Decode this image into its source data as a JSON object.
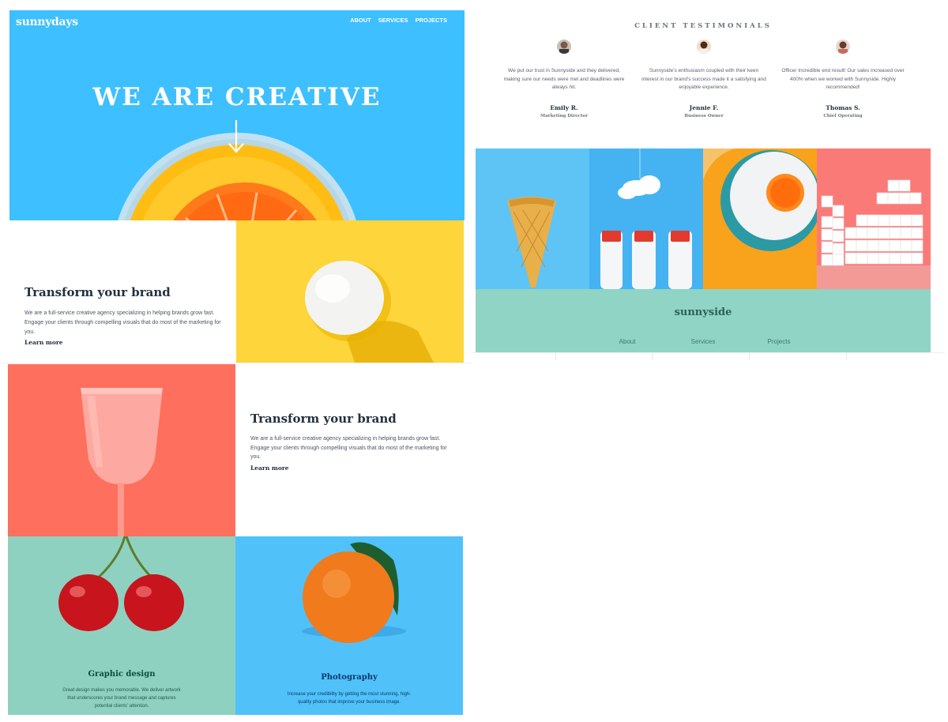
{
  "hero": {
    "logo": "sunnydays",
    "nav": [
      "ABOUT",
      "SERVICES",
      "PROJECTS"
    ],
    "title": "WE ARE CREATIVE"
  },
  "section_one": {
    "title": "Transform your brand",
    "text": "We are a full-service creative agency specializing in helping brands grow fast. Engage your clients through compelling visuals that do most of the marketing for you.",
    "link": "Learn more"
  },
  "section_two": {
    "title": "Transform your brand",
    "text": "We are a full-service creative agency specializing in helping brands grow fast. Engage your clients through compelling visuals that do most of the marketing for you.",
    "link": "Learn more"
  },
  "services": [
    {
      "title": "Graphic design",
      "text": "Great design makes you memorable. We deliver artwork that underscores your brand message and captures potential clients' attention."
    },
    {
      "title": "Photography",
      "text": "Increase your credibility by getting the most stunning, high-quality photos that improve your business image."
    }
  ],
  "testimonials": {
    "heading": "CLIENT TESTIMONIALS",
    "items": [
      {
        "quote": "We put our trust in Sunnyside and they delivered, making sure our needs were met and deadlines were always hit.",
        "name": "Emily R.",
        "role": "Marketing Director"
      },
      {
        "quote": "Sunnyside's enthusiasm coupled with their keen interest in our brand's success made it a satisfying and enjoyable experience.",
        "name": "Jennie F.",
        "role": "Business Owner"
      },
      {
        "quote": "Officer Incredible end result! Our sales increased over 400% when we worked with Sunnyside. Highly recommended!",
        "name": "Thomas S.",
        "role": "Chief Operating"
      }
    ]
  },
  "footer": {
    "logo": "sunnyside",
    "nav": [
      "About",
      "Services",
      "Projects"
    ]
  },
  "colors": {
    "hero_blue": "#3ebfff",
    "egg_yellow": "#fed53a",
    "glass_coral": "#fe6f5e",
    "graphic_teal": "#8fd1c0",
    "photo_blue": "#50c2f9",
    "footer_teal": "#90d4c5",
    "heading_dark": "#23303e"
  },
  "icons": [
    "arrow-down-icon"
  ]
}
